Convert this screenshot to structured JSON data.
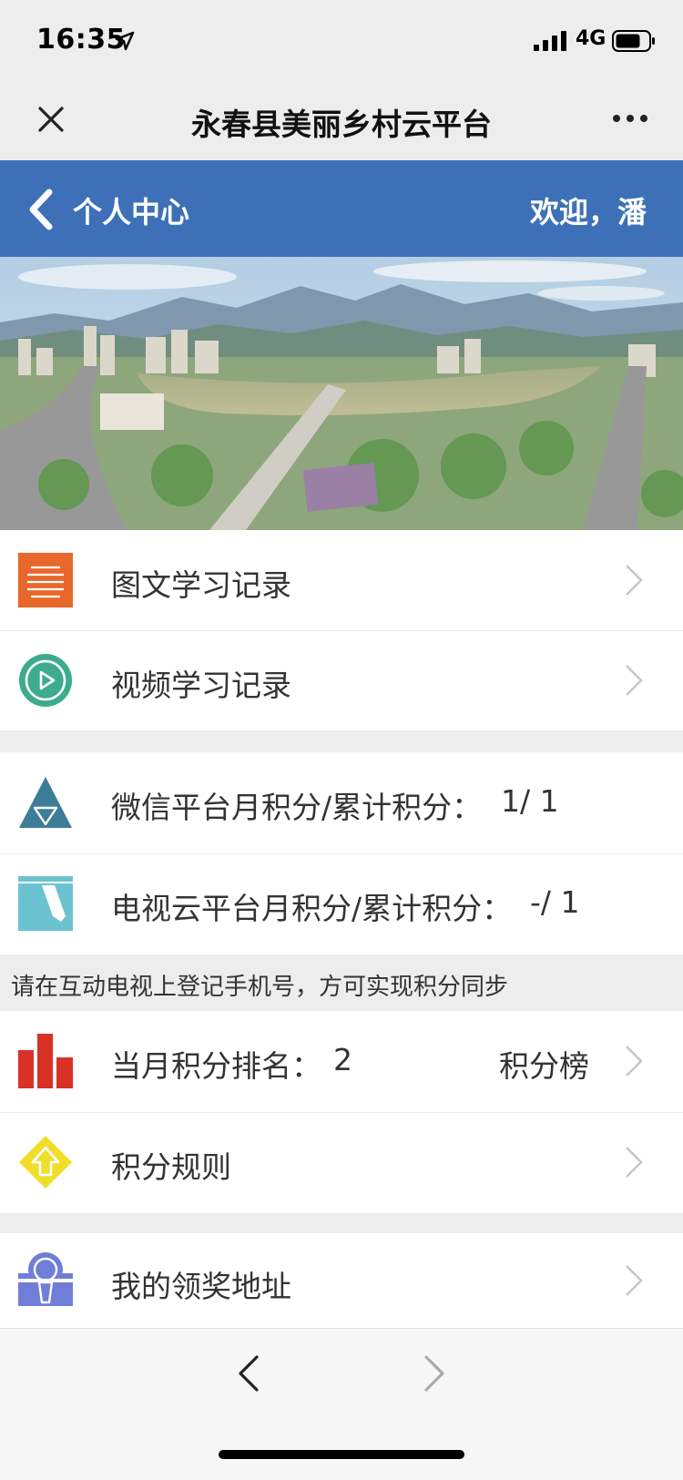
{
  "status": {
    "time": "16:35",
    "network": "4G"
  },
  "nav": {
    "title": "永春县美丽乡村云平台"
  },
  "header": {
    "title": "个人中心",
    "welcome": "欢迎，潘"
  },
  "records": [
    {
      "label": "图文学习记录",
      "icon": "article-list-icon"
    },
    {
      "label": "视频学习记录",
      "icon": "video-play-icon"
    }
  ],
  "points": {
    "wechat_label": "微信平台月积分/累计积分：",
    "wechat_value": "1/ 1",
    "tv_label": "电视云平台月积分/累计积分：",
    "tv_value": "-/ 1"
  },
  "notice": "请在互动电视上登记手机号，方可实现积分同步",
  "ranking": {
    "label": "当月积分排名：",
    "value": "2",
    "link": "积分榜"
  },
  "rules": {
    "label": "积分规则"
  },
  "address": {
    "label": "我的领奖地址"
  },
  "colors": {
    "header_blue": "#3e70b8",
    "orange": "#e8672a",
    "teal": "#3dab8c",
    "slate": "#3d7d98",
    "sky": "#6cc3d0",
    "red": "#d93126",
    "yellow": "#f0de2a",
    "purple": "#6f7fd8"
  }
}
